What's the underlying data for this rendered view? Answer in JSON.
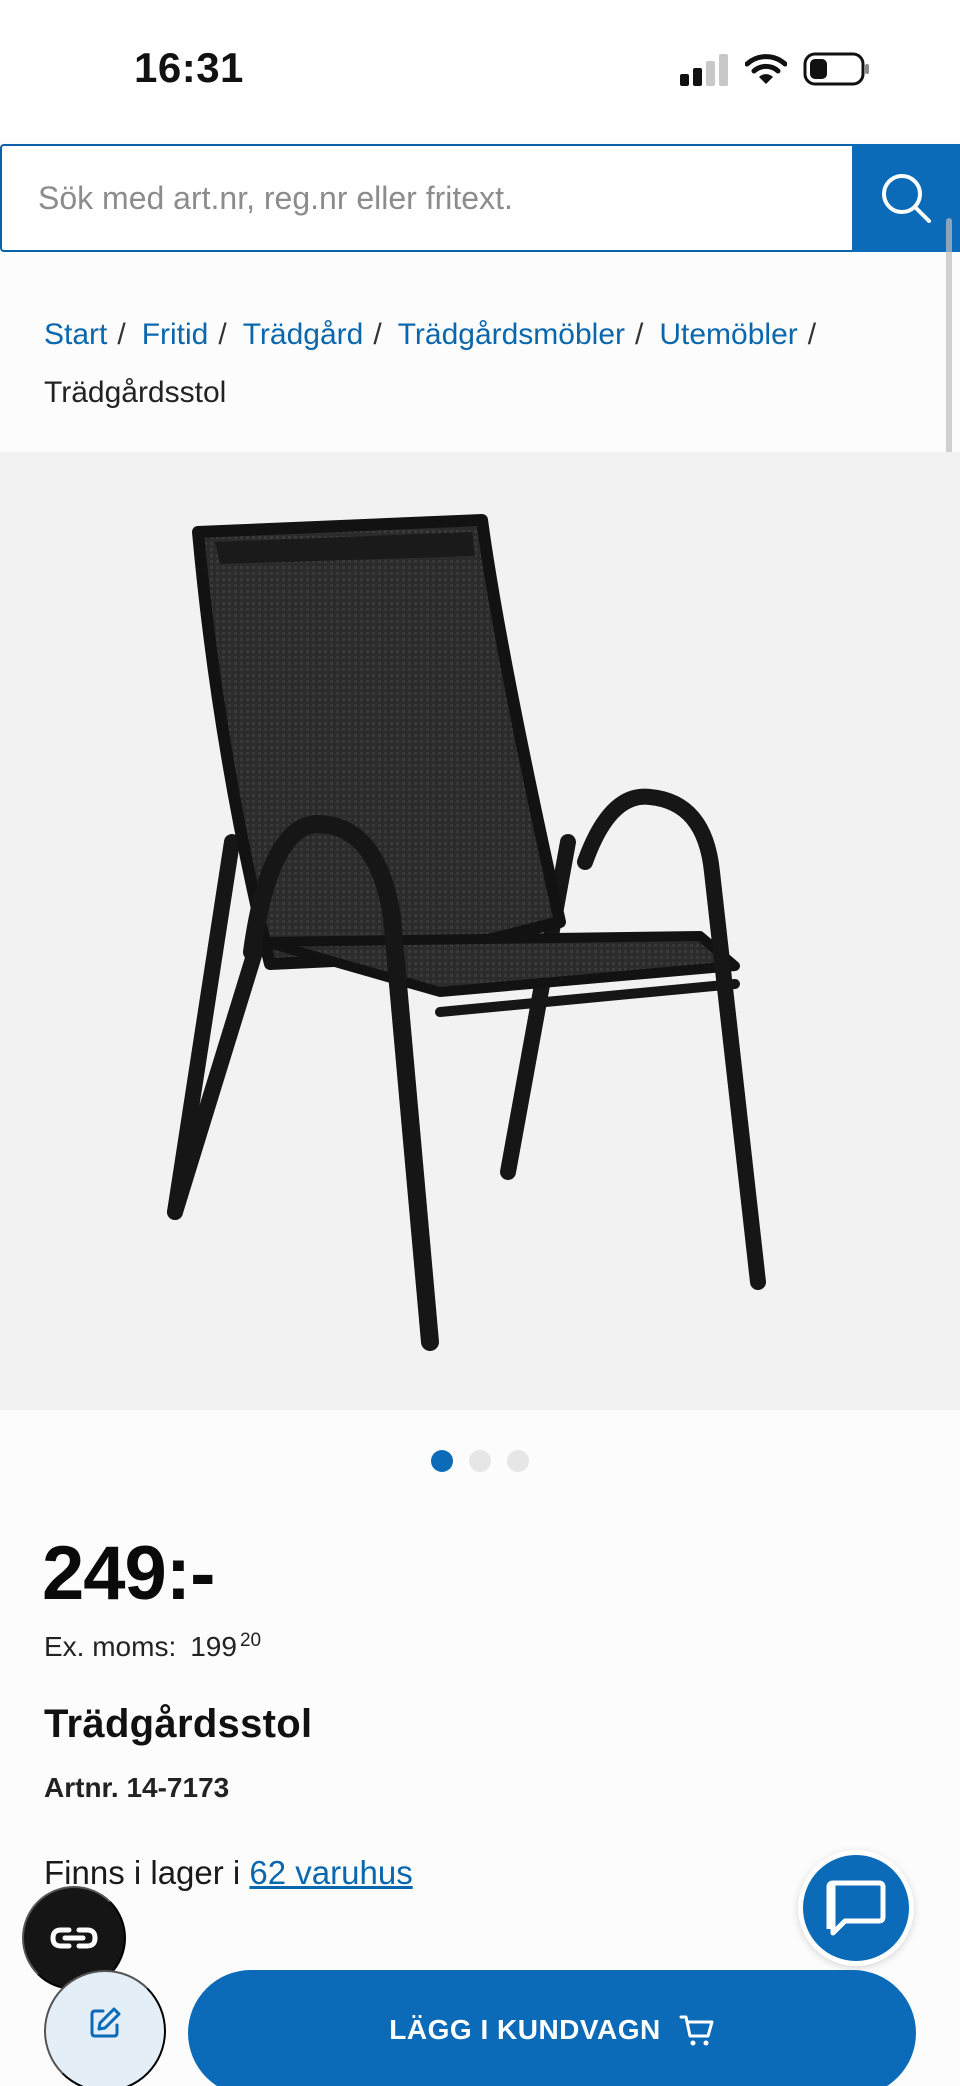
{
  "status_bar": {
    "time": "16:31"
  },
  "search": {
    "placeholder": "Sök med art.nr, reg.nr eller fritext."
  },
  "breadcrumb": {
    "links": [
      "Start",
      "Fritid",
      "Trädgård",
      "Trädgårdsmöbler",
      "Utemöbler"
    ],
    "separator": "/",
    "current": "Trädgårdsstol"
  },
  "gallery": {
    "image_count": 3,
    "active_index": 0
  },
  "product": {
    "price": "249:-",
    "ex_vat_label": "Ex. moms:",
    "ex_vat_main": "199",
    "ex_vat_decimals": "20",
    "title": "Trädgårdsstol",
    "article_number": "Artnr. 14-7173",
    "stock_prefix": "Finns i lager i ",
    "stock_link": "62 varuhus"
  },
  "actions": {
    "add_to_cart": "LÄGG I KUNDVAGN"
  },
  "icons": {
    "search": "search-icon",
    "chat": "chat-icon",
    "cookie": "cookie-settings-icon",
    "edit": "edit-icon",
    "cart": "cart-icon"
  },
  "colors": {
    "brand_blue": "#0b6bb8",
    "link_blue": "#0b67ad",
    "background": "#fcfcfc"
  }
}
